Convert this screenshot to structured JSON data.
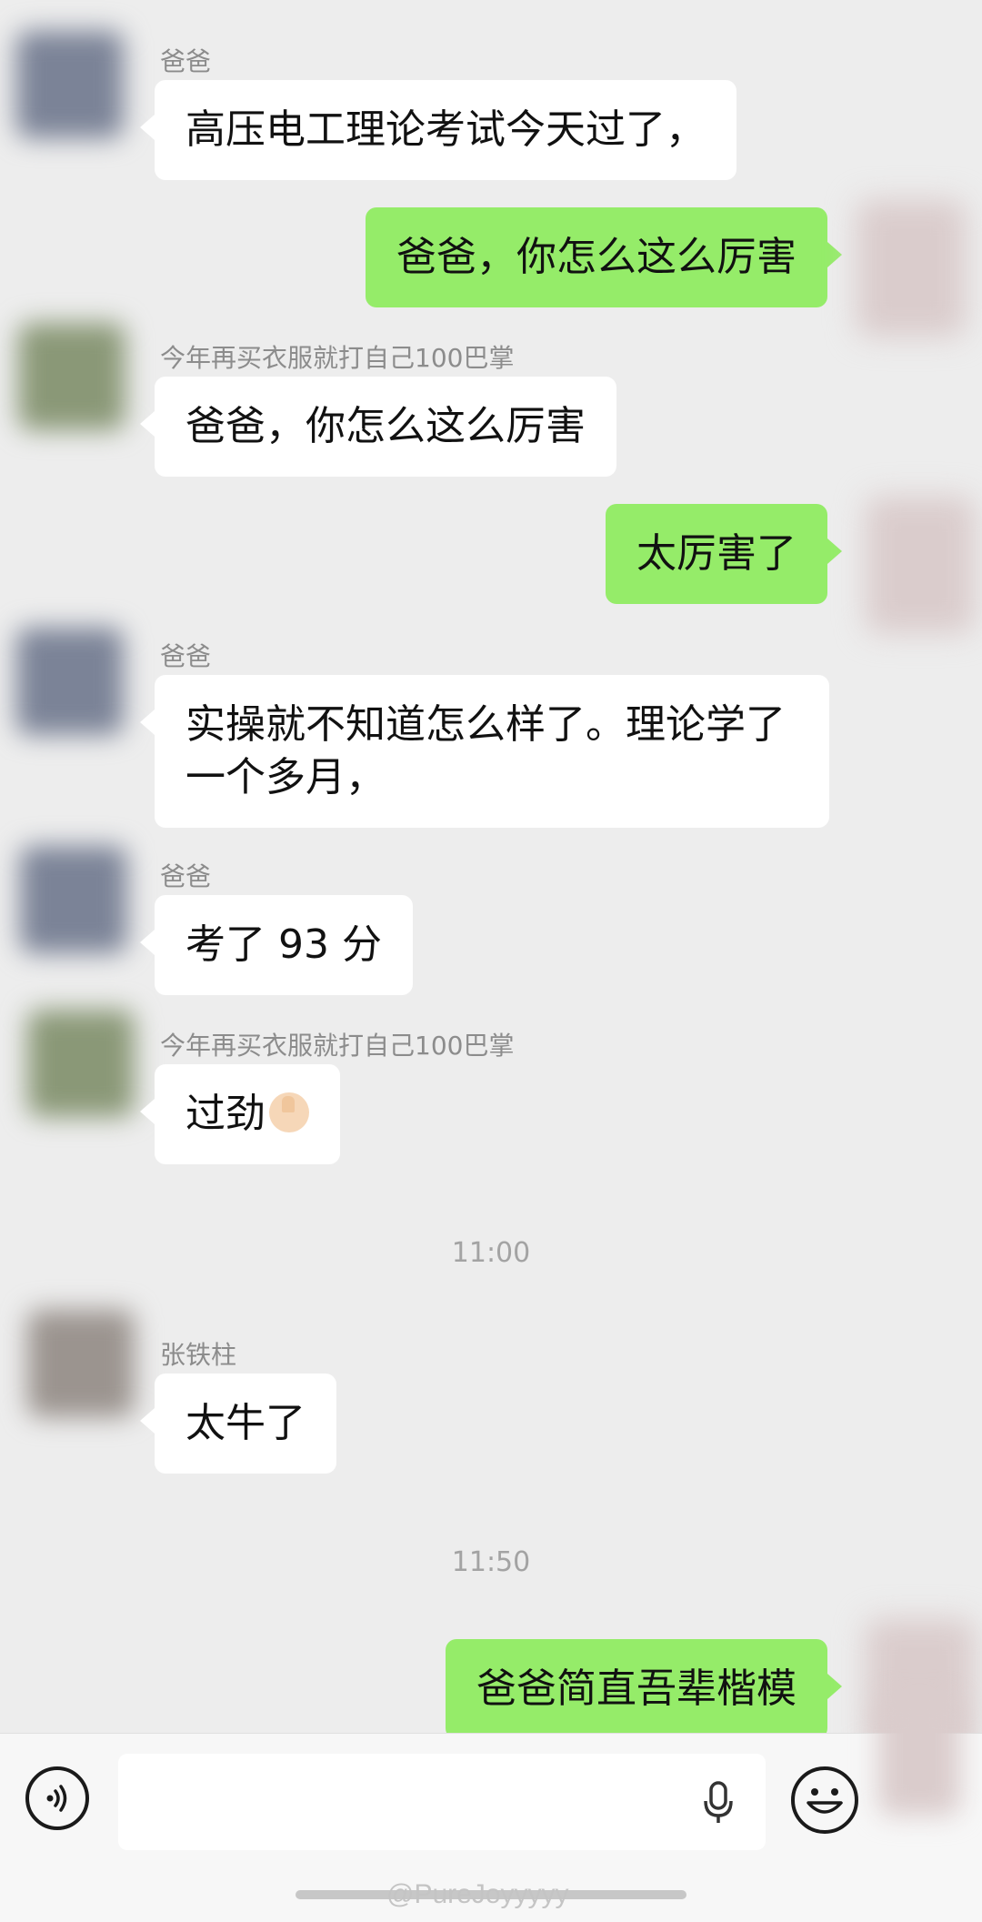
{
  "messages": [
    {
      "sender": "爸爸",
      "text": "高压电工理论考试今天过了，"
    },
    {
      "text": "爸爸，你怎么这么厉害"
    },
    {
      "sender": "今年再买衣服就打自己100巴掌",
      "text": "爸爸，你怎么这么厉害"
    },
    {
      "text": "太厉害了"
    },
    {
      "sender": "爸爸",
      "text": "实操就不知道怎么样了。理论学了一个多月，"
    },
    {
      "sender": "爸爸",
      "text": "考了 93 分"
    },
    {
      "sender": "今年再买衣服就打自己100巴掌",
      "text": "过劲",
      "emoji": "thumbs-up-icon"
    },
    {
      "time": "11:00"
    },
    {
      "sender": "张铁柱",
      "text": "太牛了"
    },
    {
      "time": "11:50"
    },
    {
      "text": "爸爸简直吾辈楷模"
    }
  ],
  "input": {
    "value": "",
    "placeholder": ""
  },
  "icons": {
    "voice": "voice-icon",
    "mic": "mic-icon",
    "emoji": "emoji-icon"
  },
  "watermark": "@PureJoyyyyy",
  "colors": {
    "background": "#ededed",
    "outgoing_bubble": "#95ec69",
    "incoming_bubble": "#ffffff"
  }
}
